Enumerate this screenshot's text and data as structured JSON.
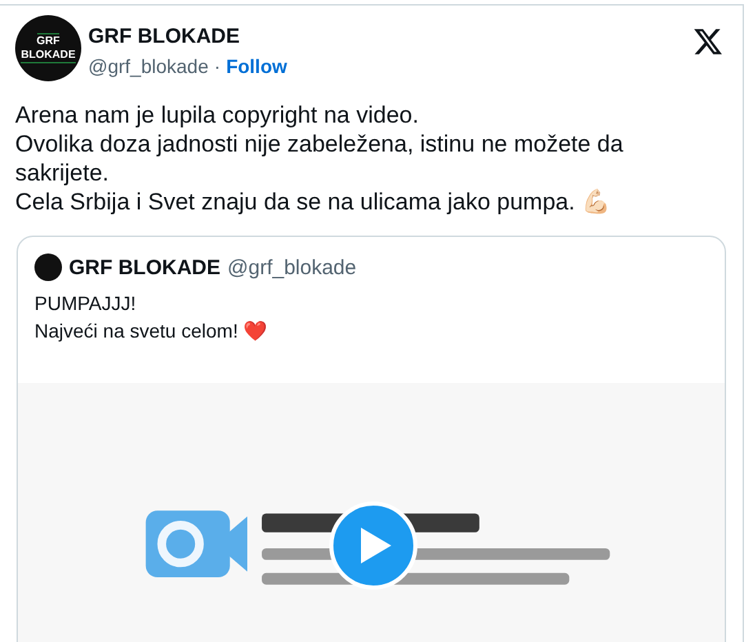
{
  "tweet": {
    "author": {
      "name": "GRF BLOKADE",
      "handle": "@grf_blokade",
      "separator": "·",
      "follow": "Follow",
      "avatar_lines": [
        "GRF",
        "BLOKADE"
      ]
    },
    "text_lines": [
      "Arena nam je lupila copyright na video.",
      "Ovolika doza jadnosti nije zabeležena, istinu ne možete da sakrijete.",
      "Cela Srbija i Svet znaju da se na ulicama jako pumpa. 💪🏻"
    ],
    "quote": {
      "name": "GRF BLOKADE",
      "handle": "@grf_blokade",
      "text_lines": [
        "PUMPAJJJ!",
        "Najveći na svetu celom! ❤️"
      ],
      "media": {
        "kind": "picture"
      }
    }
  }
}
